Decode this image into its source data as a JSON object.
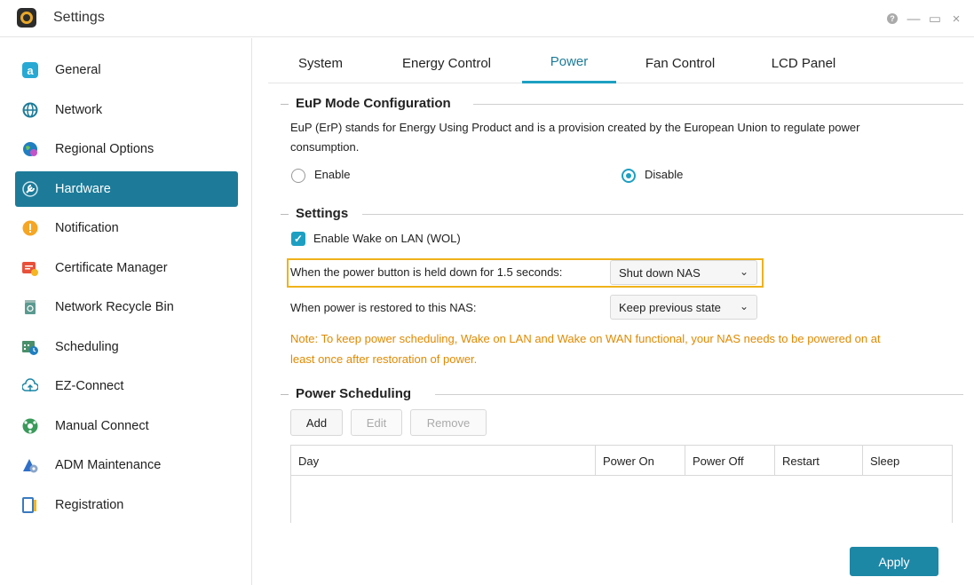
{
  "app": {
    "title": "Settings",
    "window_controls": {
      "help": "?",
      "minimize": "—",
      "maximize": "▭",
      "close": "×"
    }
  },
  "sidebar": {
    "items": [
      {
        "label": "General",
        "icon": "general-icon",
        "color": "#27a9d4"
      },
      {
        "label": "Network",
        "icon": "globe-icon",
        "color": "#1d7b99"
      },
      {
        "label": "Regional Options",
        "icon": "regional-globe-icon",
        "color": "#1f7fc0"
      },
      {
        "label": "Hardware",
        "icon": "wrench-icon",
        "color": "#ffffff",
        "active": true
      },
      {
        "label": "Notification",
        "icon": "alert-icon",
        "color": "#f5a623"
      },
      {
        "label": "Certificate Manager",
        "icon": "certificate-icon",
        "color": "#e8503a"
      },
      {
        "label": "Network Recycle Bin",
        "icon": "recycle-bin-icon",
        "color": "#5a9a8f"
      },
      {
        "label": "Scheduling",
        "icon": "calendar-clock-icon",
        "color": "#4a8f6b"
      },
      {
        "label": "EZ-Connect",
        "icon": "cloud-upload-icon",
        "color": "#1d87a6"
      },
      {
        "label": "Manual Connect",
        "icon": "manual-connect-icon",
        "color": "#3a9a5a"
      },
      {
        "label": "ADM Maintenance",
        "icon": "maintenance-icon",
        "color": "#2f6fc8"
      },
      {
        "label": "Registration",
        "icon": "registration-icon",
        "color": "#3a7ac0"
      }
    ]
  },
  "tabs": [
    {
      "label": "System"
    },
    {
      "label": "Energy Control"
    },
    {
      "label": "Power",
      "active": true
    },
    {
      "label": "Fan Control"
    },
    {
      "label": "LCD Panel"
    }
  ],
  "eup": {
    "title": "EuP Mode Configuration",
    "description_line1": "EuP (ErP) stands for Energy Using Product and is a provision created by the European Union to regulate power",
    "description_line2": "consumption.",
    "enable_label": "Enable",
    "disable_label": "Disable",
    "selected": "Disable"
  },
  "settings": {
    "title": "Settings",
    "wol_label": "Enable Wake on LAN (WOL)",
    "wol_checked": true,
    "power_button_label": "When the power button is held down for 1.5 seconds:",
    "power_button_value": "Shut down NAS",
    "power_restore_label": "When power is restored to this NAS:",
    "power_restore_value": "Keep previous state",
    "note_line1": "Note: To keep power scheduling, Wake on LAN and Wake on WAN functional, your NAS needs to be powered on at",
    "note_line2": "least once after restoration of power."
  },
  "scheduling": {
    "title": "Power Scheduling",
    "add_label": "Add",
    "edit_label": "Edit",
    "remove_label": "Remove",
    "columns": [
      "Day",
      "Power On",
      "Power Off",
      "Restart",
      "Sleep"
    ]
  },
  "footer": {
    "apply_label": "Apply"
  },
  "colors": {
    "accent": "#1d9fc2",
    "active_sidebar": "#1d7b99",
    "highlight": "#f0b21a",
    "note": "#e08a00"
  }
}
